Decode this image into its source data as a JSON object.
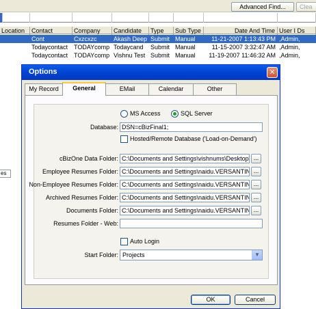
{
  "toolbar": {
    "advanced_find_label": "Advanced Find...",
    "clear_label": "Clea"
  },
  "grid": {
    "columns": [
      "Location",
      "Contact",
      "Company",
      "Candidate",
      "Type",
      "Sub Type",
      "Date And Time",
      "User I Ds"
    ],
    "rows": [
      [
        "",
        "Cont",
        "Cxzcxzc",
        "Akash Deep",
        "Submit",
        "Manual",
        "11-21-2007 1:13:43 PM",
        ",Admin,"
      ],
      [
        "",
        "Todaycontact",
        "TODAYcomp",
        "Todaycand",
        "Submit",
        "Manual",
        "11-15-2007 3:32:47 AM",
        ",Admin,"
      ],
      [
        "",
        "Todaycontact",
        "TODAYcomp",
        "Vishnu Test",
        "Submit",
        "Manual",
        "11-19-2007 11:46:32 AM",
        ",Admin,"
      ]
    ],
    "bottom_tab_label": "es"
  },
  "dialog": {
    "title": "Options",
    "close_glyph": "✕",
    "tabs": [
      "My Record",
      "General",
      "EMail",
      "Calendar",
      "Other"
    ],
    "active_tab": "General",
    "db_options": {
      "ms_access": "MS Access",
      "sql_server": "SQL Server",
      "selected": "SQL Server"
    },
    "database": {
      "label": "Database:",
      "value": "DSN=cBizFinal1;"
    },
    "hosted_label": "Hosted/Remote Database ('Load-on-Demand')",
    "hosted_checked": false,
    "folders": [
      {
        "label": "cBizOne Data Folder:",
        "value": "C:\\Documents and Settings\\vishnums\\Desktop\\v"
      },
      {
        "label": "Employee Resumes Folder:",
        "value": "C:\\Documents and Settings\\naidu.VERSANTINDI"
      },
      {
        "label": "Non-Employee Resumes Folder:",
        "value": "C:\\Documents and Settings\\naidu.VERSANTINDI"
      },
      {
        "label": "Archived Resumes Folder:",
        "value": "C:\\Documents and Settings\\naidu.VERSANTINDI"
      },
      {
        "label": "Documents Folder:",
        "value": "C:\\Documents and Settings\\naidu.VERSANTINDI"
      }
    ],
    "browse_label": "...",
    "resumes_web": {
      "label": "Resumes Folder - Web:",
      "value": ""
    },
    "auto_login_label": "Auto Login",
    "auto_login_checked": false,
    "start_folder": {
      "label": "Start Folder:",
      "value": "Projects"
    },
    "ok_label": "OK",
    "cancel_label": "Cancel"
  },
  "colors": {
    "selection": "#316ac5",
    "titlebar": "#0242d0",
    "radio_dot": "#21a121",
    "tab_highlight": "#ffc73c"
  }
}
